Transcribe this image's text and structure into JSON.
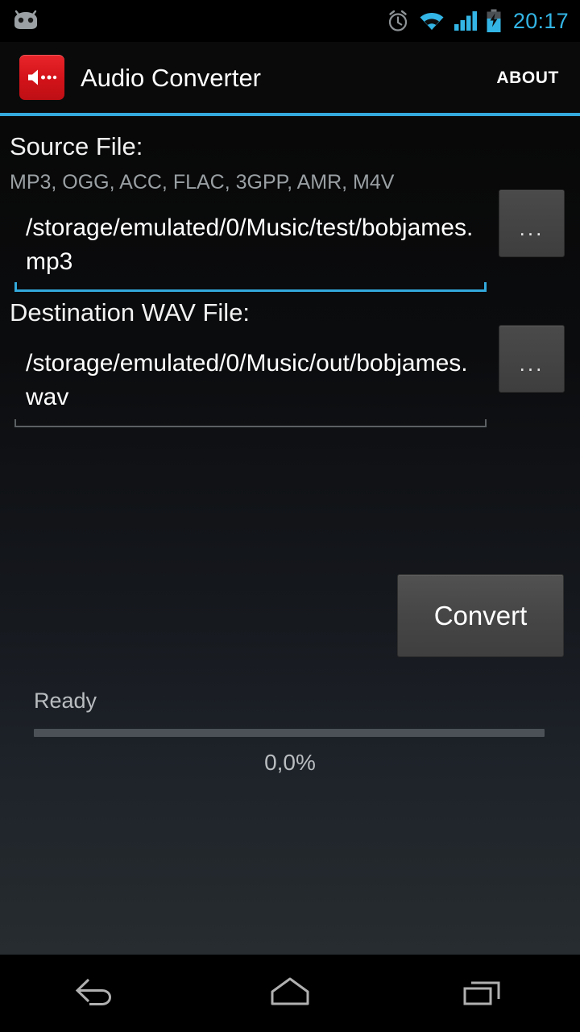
{
  "status_bar": {
    "time": "20:17",
    "icons": [
      {
        "name": "android-head-icon",
        "label": "android"
      },
      {
        "name": "alarm-clock-icon",
        "label": "alarm"
      },
      {
        "name": "wifi-icon",
        "label": "wifi"
      },
      {
        "name": "cellular-signal-icon",
        "label": "signal"
      },
      {
        "name": "battery-charging-icon",
        "label": "battery charging"
      }
    ],
    "accent_color": "#33b5e5"
  },
  "action_bar": {
    "app_icon_name": "audio-converter-app-icon",
    "title": "Audio Converter",
    "about_label": "ABOUT",
    "divider_color": "#33a9dc"
  },
  "main": {
    "source": {
      "label": "Source File:",
      "formats_hint": "MP3, OGG, ACC, FLAC, 3GPP, AMR, M4V",
      "value": "/storage/emulated/0/Music/test/bobjames.mp3",
      "browse_label": "...",
      "focused": true
    },
    "destination": {
      "label": "Destination WAV File:",
      "value": "/storage/emulated/0/Music/out/bobjames.wav",
      "browse_label": "...",
      "focused": false
    },
    "convert_label": "Convert",
    "progress": {
      "status": "Ready",
      "percent_label": "0,0%",
      "percent_value": 0
    }
  },
  "nav_bar": {
    "back_label": "Back",
    "home_label": "Home",
    "recents_label": "Recent apps"
  }
}
